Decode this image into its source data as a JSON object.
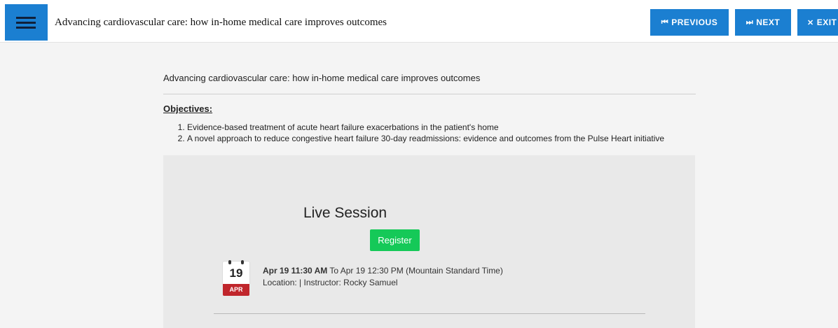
{
  "header": {
    "title": "Advancing cardiovascular care: how in-home medical care improves outcomes",
    "previous_label": "PREVIOUS",
    "next_label": "NEXT",
    "exit_label": "EXIT"
  },
  "icons": {
    "menu": "hamburger-icon",
    "previous": "skip-back-icon",
    "next": "skip-forward-icon",
    "exit": "close-icon",
    "calendar": "calendar-icon"
  },
  "colors": {
    "accent": "#1b7fd1",
    "register": "#15c958",
    "calendar_month": "#c0262c"
  },
  "course": {
    "title": "Advancing cardiovascular care: how in-home medical care improves outcomes",
    "objectives_heading": "Objectives:",
    "objectives": [
      "Evidence-based treatment of acute heart failure exacerbations in the patient's home",
      "A novel approach to reduce congestive heart failure 30-day readmissions: evidence and outcomes from the Pulse Heart initiative"
    ]
  },
  "session": {
    "heading": "Live Session",
    "register_label": "Register",
    "calendar_day": "19",
    "calendar_month": "APR",
    "start": "Apr 19 11:30 AM",
    "end_text": "To Apr 19 12:30 PM (Mountain Standard Time)",
    "location_text": "Location: | Instructor: Rocky Samuel"
  }
}
